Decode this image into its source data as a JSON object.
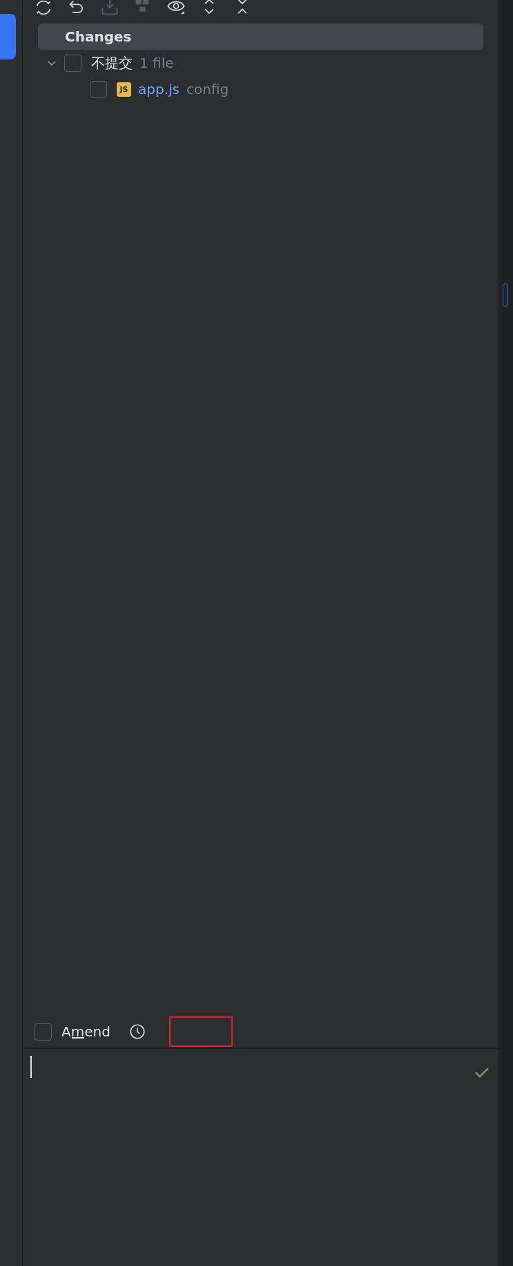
{
  "toolbar": [
    {
      "kind": "refresh",
      "disabled": false
    },
    {
      "kind": "rollback",
      "disabled": false
    },
    {
      "kind": "shelve",
      "disabled": true
    },
    {
      "kind": "group",
      "disabled": true
    },
    {
      "kind": "view",
      "disabled": false
    },
    {
      "kind": "expand",
      "disabled": false
    },
    {
      "kind": "collapse",
      "disabled": false
    }
  ],
  "tree": {
    "header": "Changes",
    "groups": [
      {
        "name": "不提交",
        "count": "1 file",
        "expanded": true,
        "checked": false,
        "files": [
          {
            "name": "app.js",
            "type_badge": "JS",
            "location": "config",
            "checked": false
          }
        ]
      }
    ]
  },
  "commit": {
    "amend": {
      "label": "Amend",
      "mnemonic_underline": true,
      "checked": false
    },
    "message": {
      "focused": true
    }
  }
}
